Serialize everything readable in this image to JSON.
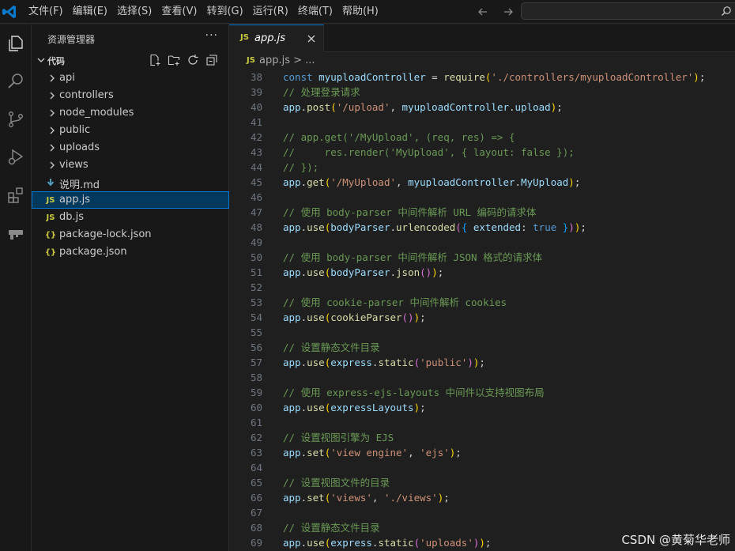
{
  "menu": [
    "文件(F)",
    "编辑(E)",
    "选择(S)",
    "查看(V)",
    "转到(G)",
    "运行(R)",
    "终端(T)",
    "帮助(H)"
  ],
  "explorer": {
    "title": "资源管理器",
    "more": "···",
    "folder": "代码",
    "items": [
      {
        "name": "api",
        "kind": "folder"
      },
      {
        "name": "controllers",
        "kind": "folder"
      },
      {
        "name": "node_modules",
        "kind": "folder"
      },
      {
        "name": "public",
        "kind": "folder"
      },
      {
        "name": "uploads",
        "kind": "folder"
      },
      {
        "name": "views",
        "kind": "folder"
      },
      {
        "name": "说明.md",
        "kind": "md"
      },
      {
        "name": "app.js",
        "kind": "js",
        "selected": true
      },
      {
        "name": "db.js",
        "kind": "js"
      },
      {
        "name": "package-lock.json",
        "kind": "json"
      },
      {
        "name": "package.json",
        "kind": "json"
      }
    ]
  },
  "tab": {
    "label": "app.js",
    "badge": "JS"
  },
  "breadcrumb": {
    "badge": "JS",
    "text": "app.js > ..."
  },
  "colors": {
    "keyword": "#569cd6",
    "var": "#9cdcfe",
    "func": "#dcdcaa",
    "string": "#ce9178",
    "comment": "#6a9955",
    "punct": "#d4d4d4",
    "bool": "#569cd6",
    "bracket_y": "#ffd700",
    "bracket_p": "#da70d6",
    "bracket_b": "#179fff"
  },
  "code_lines": [
    {
      "n": "38",
      "tokens": [
        [
          "const ",
          "keyword"
        ],
        [
          "myuploadController",
          "var"
        ],
        [
          " = ",
          "punct"
        ],
        [
          "require",
          "func"
        ],
        [
          "(",
          "bracket_y"
        ],
        [
          "'./controllers/myuploadController'",
          "string"
        ],
        [
          ")",
          "bracket_y"
        ],
        [
          ";",
          "punct"
        ]
      ]
    },
    {
      "n": "39",
      "tokens": [
        [
          "// 处理登录请求",
          "comment"
        ]
      ]
    },
    {
      "n": "40",
      "tokens": [
        [
          "app",
          "var"
        ],
        [
          ".",
          "punct"
        ],
        [
          "post",
          "func"
        ],
        [
          "(",
          "bracket_y"
        ],
        [
          "'/upload'",
          "string"
        ],
        [
          ", ",
          "punct"
        ],
        [
          "myuploadController",
          "var"
        ],
        [
          ".",
          "punct"
        ],
        [
          "upload",
          "var"
        ],
        [
          ")",
          "bracket_y"
        ],
        [
          ";",
          "punct"
        ]
      ]
    },
    {
      "n": "41",
      "tokens": []
    },
    {
      "n": "42",
      "tokens": [
        [
          "// app.get('/MyUpload', (req, res) => {",
          "comment"
        ]
      ]
    },
    {
      "n": "43",
      "tokens": [
        [
          "//     res.render('MyUpload', { layout: false });",
          "comment"
        ]
      ]
    },
    {
      "n": "44",
      "tokens": [
        [
          "// });",
          "comment"
        ]
      ]
    },
    {
      "n": "45",
      "tokens": [
        [
          "app",
          "var"
        ],
        [
          ".",
          "punct"
        ],
        [
          "get",
          "func"
        ],
        [
          "(",
          "bracket_y"
        ],
        [
          "'/MyUpload'",
          "string"
        ],
        [
          ", ",
          "punct"
        ],
        [
          "myuploadController",
          "var"
        ],
        [
          ".",
          "punct"
        ],
        [
          "MyUpload",
          "var"
        ],
        [
          ")",
          "bracket_y"
        ],
        [
          ";",
          "punct"
        ]
      ]
    },
    {
      "n": "46",
      "tokens": []
    },
    {
      "n": "47",
      "tokens": [
        [
          "// 使用 body-parser 中间件解析 URL 编码的请求体",
          "comment"
        ]
      ]
    },
    {
      "n": "48",
      "tokens": [
        [
          "app",
          "var"
        ],
        [
          ".",
          "punct"
        ],
        [
          "use",
          "func"
        ],
        [
          "(",
          "bracket_y"
        ],
        [
          "bodyParser",
          "var"
        ],
        [
          ".",
          "punct"
        ],
        [
          "urlencoded",
          "func"
        ],
        [
          "(",
          "bracket_p"
        ],
        [
          "{",
          "bracket_b"
        ],
        [
          " extended",
          "var"
        ],
        [
          ": ",
          "punct"
        ],
        [
          "true",
          "bool"
        ],
        [
          " }",
          "bracket_b"
        ],
        [
          ")",
          "bracket_p"
        ],
        [
          ")",
          "bracket_y"
        ],
        [
          ";",
          "punct"
        ]
      ]
    },
    {
      "n": "49",
      "tokens": []
    },
    {
      "n": "50",
      "tokens": [
        [
          "// 使用 body-parser 中间件解析 JSON 格式的请求体",
          "comment"
        ]
      ]
    },
    {
      "n": "51",
      "tokens": [
        [
          "app",
          "var"
        ],
        [
          ".",
          "punct"
        ],
        [
          "use",
          "func"
        ],
        [
          "(",
          "bracket_y"
        ],
        [
          "bodyParser",
          "var"
        ],
        [
          ".",
          "punct"
        ],
        [
          "json",
          "func"
        ],
        [
          "()",
          "bracket_p"
        ],
        [
          ")",
          "bracket_y"
        ],
        [
          ";",
          "punct"
        ]
      ]
    },
    {
      "n": "52",
      "tokens": []
    },
    {
      "n": "53",
      "tokens": [
        [
          "// 使用 cookie-parser 中间件解析 cookies",
          "comment"
        ]
      ]
    },
    {
      "n": "54",
      "tokens": [
        [
          "app",
          "var"
        ],
        [
          ".",
          "punct"
        ],
        [
          "use",
          "func"
        ],
        [
          "(",
          "bracket_y"
        ],
        [
          "cookieParser",
          "func"
        ],
        [
          "()",
          "bracket_p"
        ],
        [
          ")",
          "bracket_y"
        ],
        [
          ";",
          "punct"
        ]
      ]
    },
    {
      "n": "55",
      "tokens": []
    },
    {
      "n": "56",
      "tokens": [
        [
          "// 设置静态文件目录",
          "comment"
        ]
      ]
    },
    {
      "n": "57",
      "tokens": [
        [
          "app",
          "var"
        ],
        [
          ".",
          "punct"
        ],
        [
          "use",
          "func"
        ],
        [
          "(",
          "bracket_y"
        ],
        [
          "express",
          "var"
        ],
        [
          ".",
          "punct"
        ],
        [
          "static",
          "func"
        ],
        [
          "(",
          "bracket_p"
        ],
        [
          "'public'",
          "string"
        ],
        [
          ")",
          "bracket_p"
        ],
        [
          ")",
          "bracket_y"
        ],
        [
          ";",
          "punct"
        ]
      ]
    },
    {
      "n": "58",
      "tokens": []
    },
    {
      "n": "59",
      "tokens": [
        [
          "// 使用 express-ejs-layouts 中间件以支持视图布局",
          "comment"
        ]
      ]
    },
    {
      "n": "60",
      "tokens": [
        [
          "app",
          "var"
        ],
        [
          ".",
          "punct"
        ],
        [
          "use",
          "func"
        ],
        [
          "(",
          "bracket_y"
        ],
        [
          "expressLayouts",
          "var"
        ],
        [
          ")",
          "bracket_y"
        ],
        [
          ";",
          "punct"
        ]
      ]
    },
    {
      "n": "61",
      "tokens": []
    },
    {
      "n": "62",
      "tokens": [
        [
          "// 设置视图引擎为 EJS",
          "comment"
        ]
      ]
    },
    {
      "n": "63",
      "tokens": [
        [
          "app",
          "var"
        ],
        [
          ".",
          "punct"
        ],
        [
          "set",
          "func"
        ],
        [
          "(",
          "bracket_y"
        ],
        [
          "'view engine'",
          "string"
        ],
        [
          ", ",
          "punct"
        ],
        [
          "'ejs'",
          "string"
        ],
        [
          ")",
          "bracket_y"
        ],
        [
          ";",
          "punct"
        ]
      ]
    },
    {
      "n": "64",
      "tokens": []
    },
    {
      "n": "65",
      "tokens": [
        [
          "// 设置视图文件的目录",
          "comment"
        ]
      ]
    },
    {
      "n": "66",
      "tokens": [
        [
          "app",
          "var"
        ],
        [
          ".",
          "punct"
        ],
        [
          "set",
          "func"
        ],
        [
          "(",
          "bracket_y"
        ],
        [
          "'views'",
          "string"
        ],
        [
          ", ",
          "punct"
        ],
        [
          "'./views'",
          "string"
        ],
        [
          ")",
          "bracket_y"
        ],
        [
          ";",
          "punct"
        ]
      ]
    },
    {
      "n": "67",
      "tokens": []
    },
    {
      "n": "68",
      "tokens": [
        [
          "// 设置静态文件目录",
          "comment"
        ]
      ]
    },
    {
      "n": "69",
      "tokens": [
        [
          "app",
          "var"
        ],
        [
          ".",
          "punct"
        ],
        [
          "use",
          "func"
        ],
        [
          "(",
          "bracket_y"
        ],
        [
          "express",
          "var"
        ],
        [
          ".",
          "punct"
        ],
        [
          "static",
          "func"
        ],
        [
          "(",
          "bracket_p"
        ],
        [
          "'uploads'",
          "string"
        ],
        [
          ")",
          "bracket_p"
        ],
        [
          ")",
          "bracket_y"
        ],
        [
          ";",
          "punct"
        ]
      ]
    }
  ],
  "watermark": "CSDN @黄菊华老师",
  "icons": {
    "logo": "vscode-logo-icon",
    "activity": [
      "explorer-icon",
      "search-icon",
      "source-control-icon",
      "run-debug-icon",
      "extensions-icon",
      "remote-explorer-icon"
    ]
  }
}
